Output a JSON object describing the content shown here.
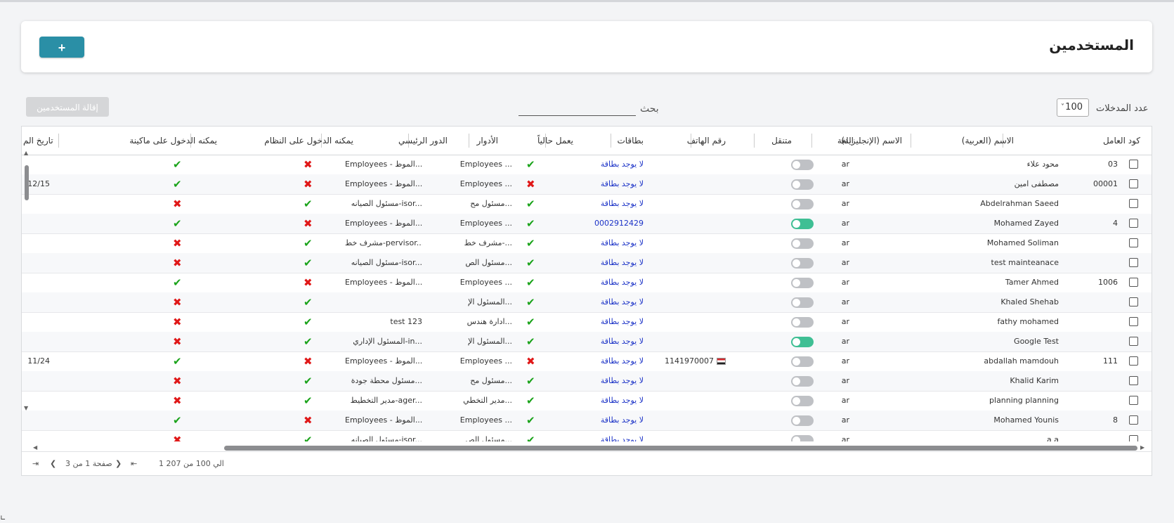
{
  "header": {
    "title": "المستخدمين",
    "add_label": "+"
  },
  "toolbar": {
    "entries_label": "عدد المدخلات",
    "entries_value": "100",
    "search_label": "بحث",
    "remove_label": "إقالة المستخدمين"
  },
  "table": {
    "columns": [
      "كود العامل",
      "الاسم (العربية)",
      "الاسم (الإنجليزية)",
      "اللغة",
      "متنقل",
      "رقم الهاتف",
      "بطاقات",
      "يعمل حالياً",
      "الأدوار",
      "الدور الرئيسي",
      "يمكنه الدخول على النظام",
      "يمكنه الدخول على ماكينة",
      "تاريخ الم"
    ],
    "rows": [
      {
        "code": "03",
        "ar": "محود علاء",
        "en": "",
        "lang": "ar",
        "mobile": false,
        "phone": "",
        "card": "لا يوجد بطاقة",
        "active": true,
        "roles": "Employees ...",
        "main": "Employees - الموظ...",
        "system": false,
        "machine": true,
        "date": ""
      },
      {
        "code": "00001",
        "ar": "مصطفى امين",
        "en": "",
        "lang": "ar",
        "mobile": false,
        "phone": "",
        "card": "لا يوجد بطاقة",
        "active": false,
        "roles": "Employees ...",
        "main": "Employees - الموظ...",
        "system": false,
        "machine": true,
        "date": "12/15"
      },
      {
        "code": "",
        "ar": "Abdelrahman Saeed",
        "en": "",
        "lang": "ar",
        "mobile": false,
        "phone": "",
        "card": "لا يوجد بطاقة",
        "active": true,
        "roles": "مسئول مح...",
        "main": "مسئول الصيانه-isor...",
        "system": true,
        "machine": false,
        "date": ""
      },
      {
        "code": "4",
        "ar": "Mohamed Zayed",
        "en": "",
        "lang": "ar",
        "mobile": true,
        "phone": "",
        "card": "0002912429",
        "active": true,
        "roles": "Employees ...",
        "main": "Employees - الموظ...",
        "system": false,
        "machine": true,
        "date": ""
      },
      {
        "code": "",
        "ar": "Mohamed Soliman",
        "en": "",
        "lang": "ar",
        "mobile": false,
        "phone": "",
        "card": "لا يوجد بطاقة",
        "active": true,
        "roles": "مشرف خط-...",
        "main": "مشرف خط-pervisor...",
        "system": true,
        "machine": false,
        "date": ""
      },
      {
        "code": "",
        "ar": "test mainteanace",
        "en": "",
        "lang": "ar",
        "mobile": false,
        "phone": "",
        "card": "لا يوجد بطاقة",
        "active": true,
        "roles": "مسئول الص...",
        "main": "مسئول الصيانه-isor...",
        "system": true,
        "machine": false,
        "date": ""
      },
      {
        "code": "1006",
        "ar": "Tamer Ahmed",
        "en": "",
        "lang": "ar",
        "mobile": false,
        "phone": "",
        "card": "لا يوجد بطاقة",
        "active": true,
        "roles": "Employees ...",
        "main": "Employees - الموظ...",
        "system": false,
        "machine": true,
        "date": ""
      },
      {
        "code": "",
        "ar": "Khaled Shehab",
        "en": "",
        "lang": "ar",
        "mobile": false,
        "phone": "",
        "card": "لا يوجد بطاقة",
        "active": true,
        "roles": "المسئول الإ...",
        "main": "",
        "system": true,
        "machine": false,
        "date": ""
      },
      {
        "code": "",
        "ar": "fathy mohamed",
        "en": "",
        "lang": "ar",
        "mobile": false,
        "phone": "",
        "card": "لا يوجد بطاقة",
        "active": true,
        "roles": "ادارة هندس...",
        "main": "test 123",
        "system": true,
        "machine": false,
        "date": ""
      },
      {
        "code": "",
        "ar": "Google Test",
        "en": "",
        "lang": "ar",
        "mobile": true,
        "phone": "",
        "card": "لا يوجد بطاقة",
        "active": true,
        "roles": "المسئول الإ...",
        "main": "المسئول الإداري-in...",
        "system": true,
        "machine": false,
        "date": ""
      },
      {
        "code": "111",
        "ar": "abdallah mamdouh",
        "en": "",
        "lang": "ar",
        "mobile": false,
        "phone": "1141970007",
        "card": "لا يوجد بطاقة",
        "active": false,
        "roles": "Employees ...",
        "main": "Employees - الموظ...",
        "system": false,
        "machine": true,
        "date": "11/24"
      },
      {
        "code": "",
        "ar": "Khalid Karim",
        "en": "",
        "lang": "ar",
        "mobile": false,
        "phone": "",
        "card": "لا يوجد بطاقة",
        "active": true,
        "roles": "مسئول مح...",
        "main": "مسئول محطة جودة...",
        "system": true,
        "machine": false,
        "date": ""
      },
      {
        "code": "",
        "ar": "planning planning",
        "en": "",
        "lang": "ar",
        "mobile": false,
        "phone": "",
        "card": "لا يوجد بطاقة",
        "active": true,
        "roles": "مدير التخطي...",
        "main": "مدير التخطيط-ager...",
        "system": true,
        "machine": false,
        "date": ""
      },
      {
        "code": "8",
        "ar": "Mohamed Younis",
        "en": "",
        "lang": "ar",
        "mobile": false,
        "phone": "",
        "card": "لا يوجد بطاقة",
        "active": true,
        "roles": "Employees ...",
        "main": "Employees - الموظ...",
        "system": false,
        "machine": true,
        "date": ""
      },
      {
        "code": "",
        "ar": "a a",
        "en": "",
        "lang": "ar",
        "mobile": false,
        "phone": "",
        "card": "لا يوجد بطاقة",
        "active": true,
        "roles": "مسئول الص...",
        "main": "مسئول الصيانه-isor...",
        "system": true,
        "machine": false,
        "date": ""
      }
    ]
  },
  "footer": {
    "range": "1 الي 100 من 207",
    "page": "صفحة 1 من 3"
  },
  "icons": {
    "check": "check-icon",
    "cross": "cross-icon"
  },
  "colors": {
    "primary": "#2a8fa6",
    "link": "#1b32c7",
    "ok": "#1aa31a",
    "no": "#e01818",
    "toggle_on": "#3fbf94"
  }
}
